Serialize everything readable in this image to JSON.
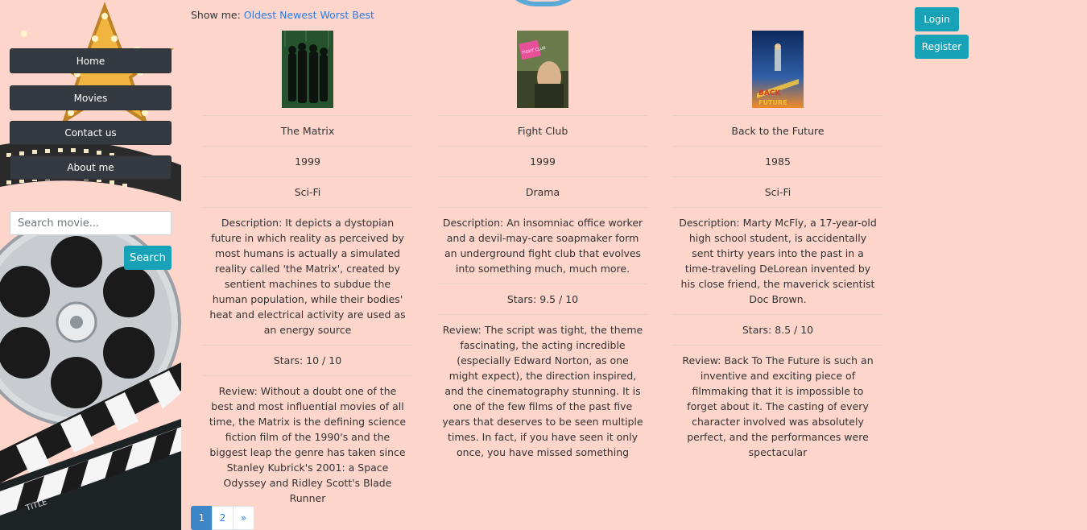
{
  "sidebar": {
    "nav": [
      {
        "label": "Home"
      },
      {
        "label": "Movies"
      },
      {
        "label": "Contact us"
      },
      {
        "label": "About me"
      }
    ],
    "search": {
      "placeholder": "Search movie...",
      "button_label": "Search"
    },
    "clapper_text": "TITLE"
  },
  "sort": {
    "prefix": "Show me:",
    "options": [
      "Oldest",
      "Newest",
      "Worst",
      "Best"
    ]
  },
  "auth": {
    "login_label": "Login",
    "register_label": "Register"
  },
  "movies": [
    {
      "title": "The Matrix",
      "year": "1999",
      "genre": "Sci-Fi",
      "description": "Description: It depicts a dystopian future in which reality as perceived by most humans is actually a simulated reality called 'the Matrix', created by sentient machines to subdue the human population, while their bodies' heat and electrical activity are used as an energy source",
      "stars": "Stars: 10 / 10",
      "review": "Review: Without a doubt one of the best and most influential movies of all time, the Matrix is the defining science fiction film of the 1990's and the biggest leap the genre has taken since Stanley Kubrick's 2001: a Space Odyssey and Ridley Scott's Blade Runner"
    },
    {
      "title": "Fight Club",
      "year": "1999",
      "genre": "Drama",
      "description": "Description: An insomniac office worker and a devil-may-care soapmaker form an underground fight club that evolves into something much, much more.",
      "stars": "Stars: 9.5 / 10",
      "review": "Review: The script was tight, the theme fascinating, the acting incredible (especially Edward Norton, as one might expect), the direction inspired, and the cinematography stunning. It is one of the few films of the past five years that deserves to be seen multiple times. In fact, if you have seen it only once, you have missed something"
    },
    {
      "title": "Back to the Future",
      "year": "1985",
      "genre": "Sci-Fi",
      "description": "Description: Marty McFly, a 17-year-old high school student, is accidentally sent thirty years into the past in a time-traveling DeLorean invented by his close friend, the maverick scientist Doc Brown.",
      "stars": "Stars: 8.5 / 10",
      "review": "Review: Back To The Future is such an inventive and exciting piece of filmmaking that it is impossible to forget about it. The casting of every character involved was absolutely perfect, and the performances were spectacular"
    }
  ],
  "posters": {
    "matrix_text": "",
    "fightclub_text": "FIGHT CLUB",
    "bttf_line1": "BACK",
    "bttf_line2": "FUTURE"
  },
  "pagination": {
    "pages": [
      "1",
      "2",
      "»"
    ],
    "active": "1"
  },
  "colors": {
    "background": "#fdd5cb",
    "nav_button": "#343a40",
    "accent_teal": "#17a2b8",
    "link": "#2c7be5"
  }
}
